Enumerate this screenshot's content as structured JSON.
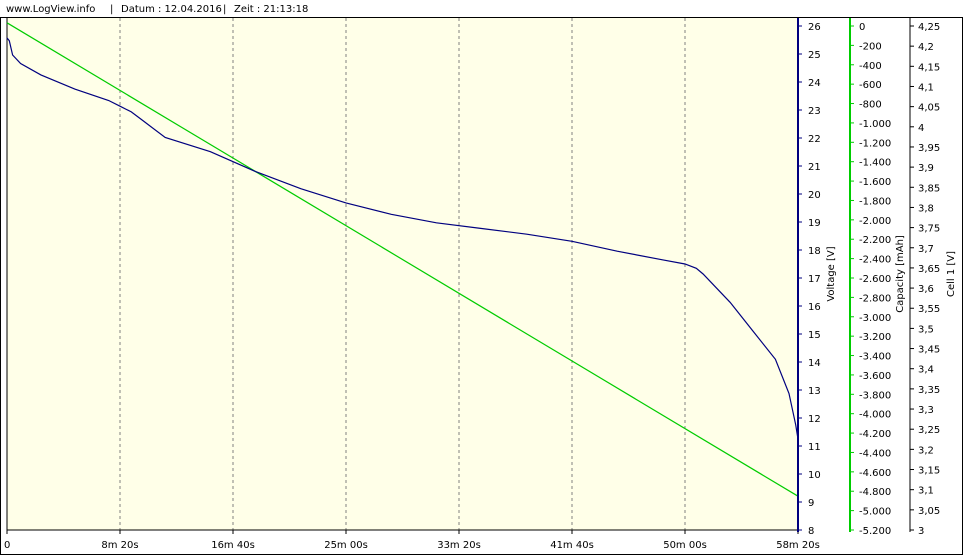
{
  "header": {
    "site": "www.LogView.info",
    "sep1": "|",
    "date": "Datum : 12.04.2016",
    "sep2": "|",
    "time": "Zeit : 21:13:18"
  },
  "colors": {
    "plot_bg": "#FFFFE8",
    "voltage": "#00007F",
    "capacity": "#00CC00",
    "cell": "#000000",
    "grid": "#808080"
  },
  "chart_data": {
    "type": "line",
    "x_ticks": [
      "0",
      "8m 20s",
      "16m 40s",
      "25m 00s",
      "33m 20s",
      "41m 40s",
      "50m 00s",
      "58m 20s"
    ],
    "x_unit_note": "x values in seconds",
    "xlim": [
      0,
      3500
    ],
    "grid": "vertical",
    "axes": [
      {
        "id": "voltage",
        "label": "Voltage [V]",
        "range": [
          8,
          26
        ],
        "ticks": [
          "26",
          "25",
          "24",
          "23",
          "22",
          "21",
          "20",
          "19",
          "18",
          "17",
          "16",
          "15",
          "14",
          "13",
          "12",
          "11",
          "10",
          "9",
          "8"
        ]
      },
      {
        "id": "capacity",
        "label": "Capacity [mAh]",
        "range": [
          -5200,
          100
        ],
        "ticks": [
          "0",
          "-200",
          "-400",
          "-600",
          "-800",
          "-1.000",
          "-1.200",
          "-1.400",
          "-1.600",
          "-1.800",
          "-2.000",
          "-2.200",
          "-2.400",
          "-2.600",
          "-2.800",
          "-3.000",
          "-3.200",
          "-3.400",
          "-3.600",
          "-3.800",
          "-4.000",
          "-4.200",
          "-4.400",
          "-4.600",
          "-4.800",
          "-5.000",
          "-5.200"
        ]
      },
      {
        "id": "cell",
        "label": "Cell 1 [V]",
        "range": [
          3.0,
          4.25
        ],
        "ticks": [
          "4,25",
          "4,2",
          "4,15",
          "4,1",
          "4,05",
          "4",
          "3,95",
          "3,9",
          "3,85",
          "3,8",
          "3,75",
          "3,7",
          "3,65",
          "3,6",
          "3,55",
          "3,5",
          "3,45",
          "3,4",
          "3,35",
          "3,3",
          "3,25",
          "3,2",
          "3,15",
          "3,1",
          "3,05",
          "3"
        ]
      }
    ],
    "series": [
      {
        "axis": "voltage",
        "x": [
          0,
          10,
          25,
          60,
          150,
          300,
          450,
          500,
          550,
          600,
          700,
          900,
          1100,
          1300,
          1500,
          1700,
          1900,
          2100,
          2300,
          2500,
          2700,
          2900,
          3000,
          3050,
          3080,
          3200,
          3300,
          3400,
          3460,
          3490,
          3500
        ],
        "values": [
          25.3,
          25.2,
          24.7,
          24.4,
          24.0,
          23.5,
          23.1,
          22.9,
          22.7,
          22.4,
          21.8,
          21.3,
          20.6,
          20.0,
          19.5,
          19.1,
          18.8,
          18.6,
          18.4,
          18.15,
          17.8,
          17.5,
          17.35,
          17.2,
          17.0,
          16.0,
          15.0,
          14.0,
          12.8,
          11.7,
          11.2
        ]
      },
      {
        "axis": "capacity",
        "x": [
          0,
          3500
        ],
        "values": [
          50,
          -4850
        ]
      }
    ]
  }
}
